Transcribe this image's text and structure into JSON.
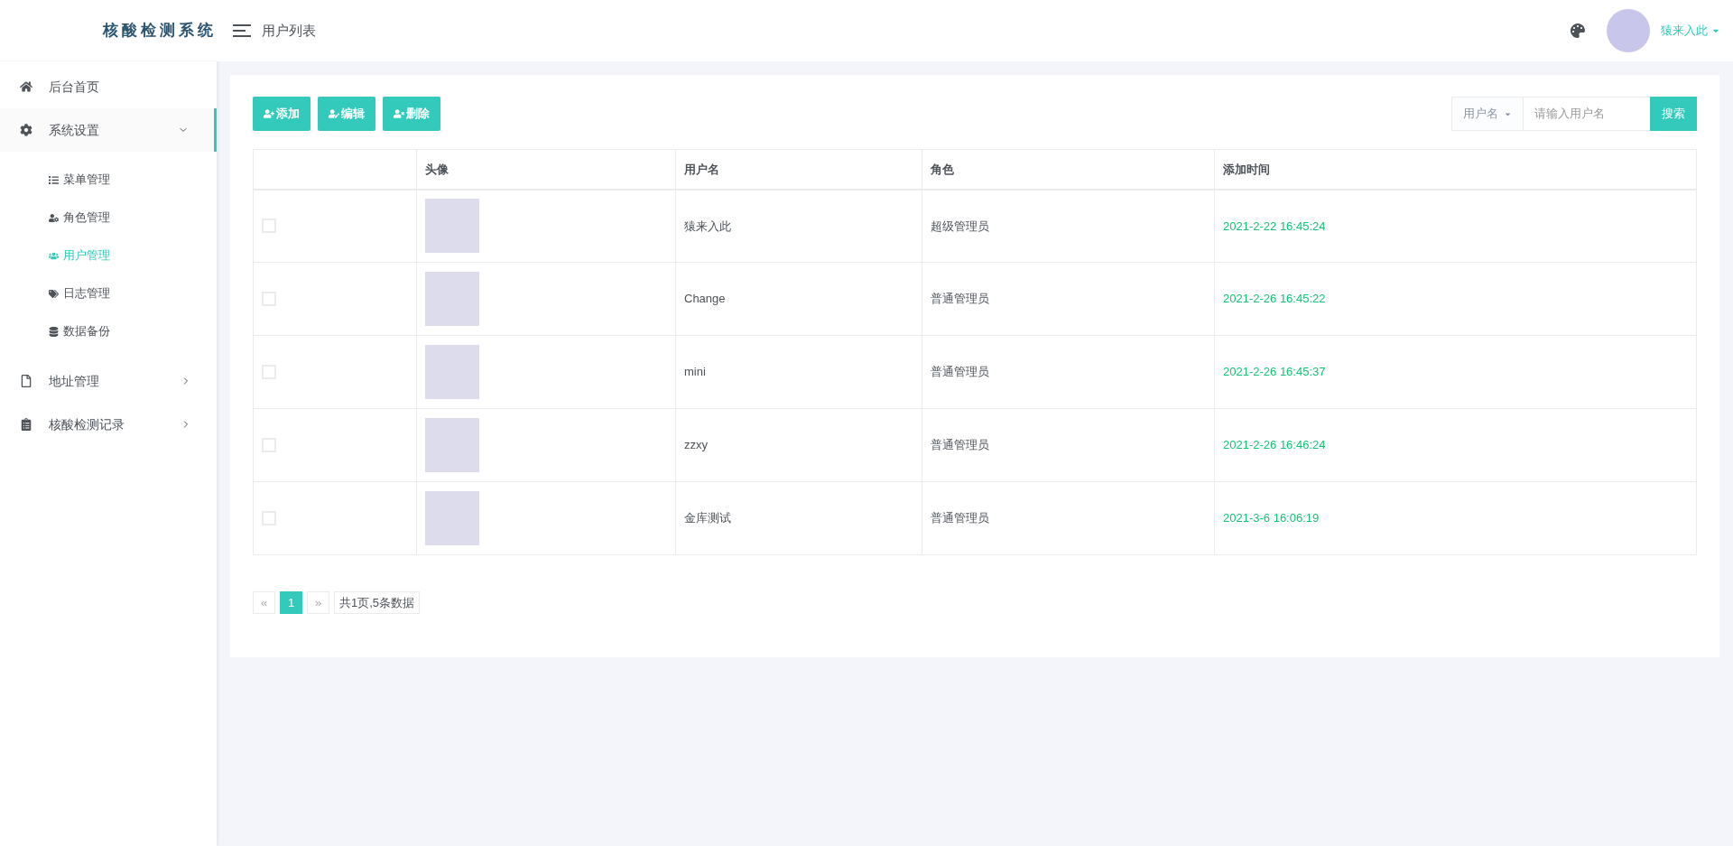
{
  "logo": "核酸检测系统",
  "header": {
    "title": "用户列表",
    "user": "猿来入此"
  },
  "sidebar": {
    "items": [
      {
        "label": "后台首页",
        "kind": "link",
        "selected": false
      },
      {
        "label": "系统设置",
        "kind": "group",
        "selected": true,
        "expanded": true,
        "children": [
          {
            "label": "菜单管理",
            "selected": false
          },
          {
            "label": "角色管理",
            "selected": false
          },
          {
            "label": "用户管理",
            "selected": true
          },
          {
            "label": "日志管理",
            "selected": false
          },
          {
            "label": "数据备份",
            "selected": false
          }
        ]
      },
      {
        "label": "地址管理",
        "kind": "group",
        "selected": false,
        "expanded": false
      },
      {
        "label": "核酸检测记录",
        "kind": "group",
        "selected": false,
        "expanded": false
      }
    ]
  },
  "toolbar": {
    "buttons": [
      "添加",
      "编辑",
      "删除"
    ],
    "search": {
      "filter": "用户名",
      "placeholder": "请输入用户名",
      "button": "搜索"
    }
  },
  "table": {
    "columns": [
      "头像",
      "用户名",
      "角色",
      "添加时间"
    ],
    "rows": [
      {
        "checked": false,
        "username": "猿来入此",
        "role": "超级管理员",
        "time": "2021-2-22 16:45:24"
      },
      {
        "checked": false,
        "username": "Change",
        "role": "普通管理员",
        "time": "2021-2-26 16:45:22"
      },
      {
        "checked": false,
        "username": "mini",
        "role": "普通管理员",
        "time": "2021-2-26 16:45:37"
      },
      {
        "checked": false,
        "username": "zzxy",
        "role": "普通管理员",
        "time": "2021-2-26 16:46:24"
      },
      {
        "checked": false,
        "username": "金库测试",
        "role": "普通管理员",
        "time": "2021-3-6 16:06:19"
      }
    ]
  },
  "pagination": {
    "prev": "«",
    "pages": [
      {
        "label": "1",
        "selected": true
      }
    ],
    "next": "»",
    "summary": "共1页,5条数据"
  }
}
